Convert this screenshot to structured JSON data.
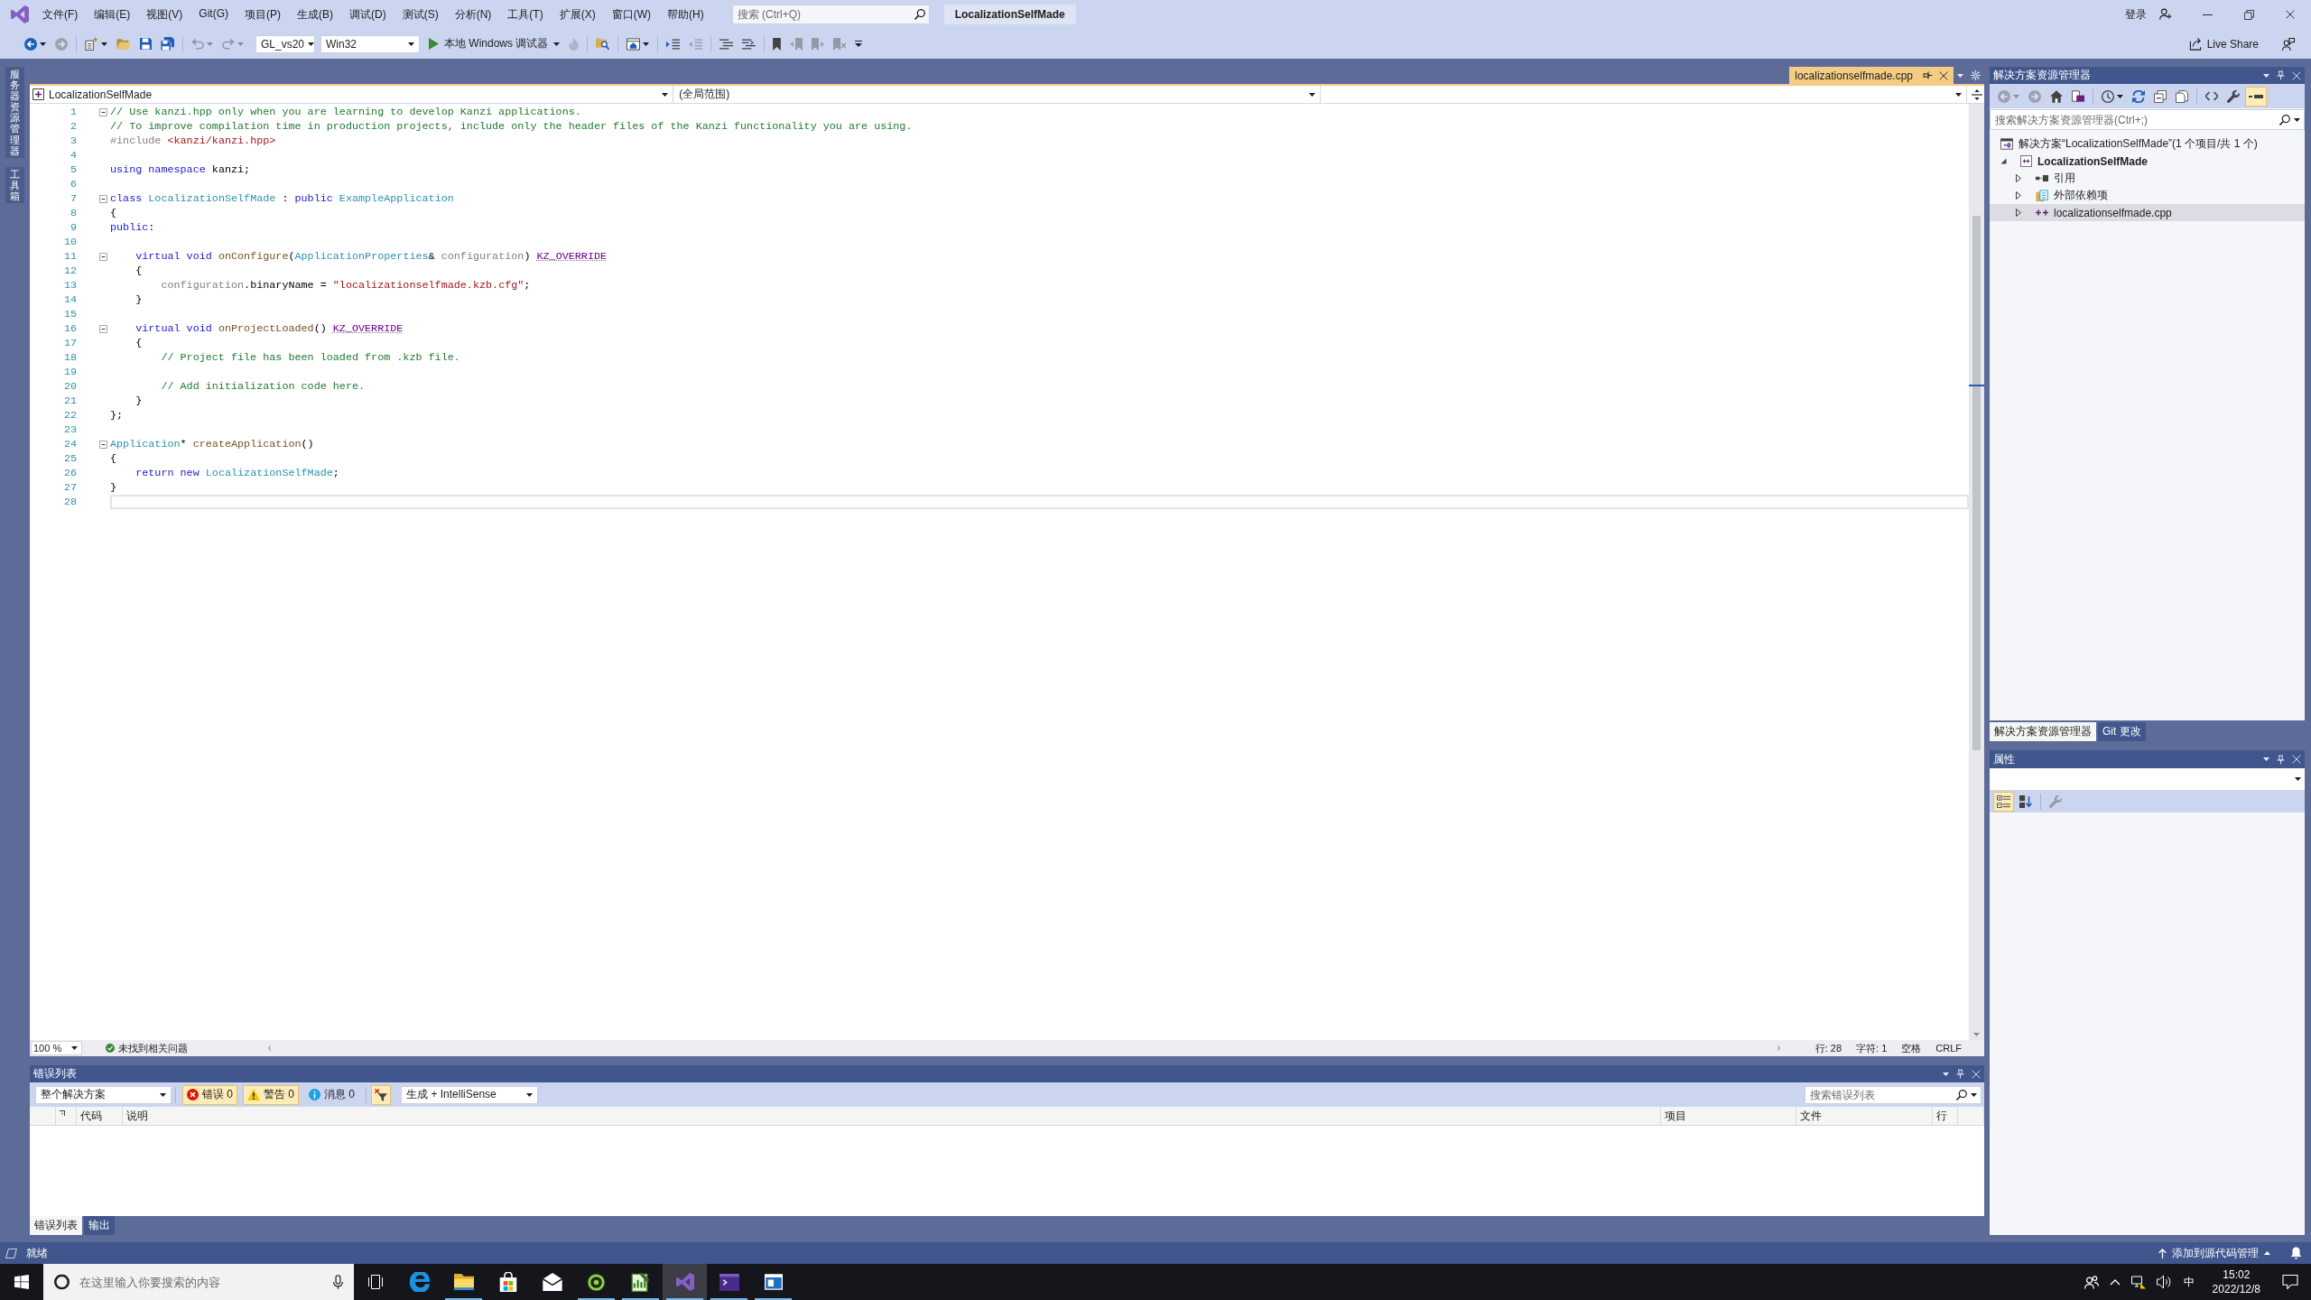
{
  "title_bar": {
    "menu": [
      "文件(F)",
      "编辑(E)",
      "视图(V)",
      "Git(G)",
      "项目(P)",
      "生成(B)",
      "调试(D)",
      "测试(S)",
      "分析(N)",
      "工具(T)",
      "扩展(X)",
      "窗口(W)",
      "帮助(H)"
    ],
    "search": {
      "placeholder": "搜索 (Ctrl+Q)"
    },
    "title": "LocalizationSelfMade",
    "account": "登录"
  },
  "toolbar": {
    "left": [
      {
        "kind": "back",
        "disabled": false
      },
      {
        "kind": "forward",
        "disabled": true
      },
      {
        "kind": "newitem",
        "disabled": false
      },
      {
        "kind": "open",
        "disabled": false
      },
      {
        "kind": "save",
        "disabled": false
      },
      {
        "kind": "saveall",
        "disabled": false
      },
      {
        "kind": "undo",
        "disabled": true
      },
      {
        "kind": "redo",
        "disabled": true
      }
    ],
    "configuration": "GL_vs20",
    "platform": "Win32",
    "debugger": "本地 Windows 调试器",
    "right": [
      {
        "kind": "flame",
        "disabled": true
      },
      {
        "kind": "findfiles",
        "disabled": false
      },
      {
        "kind": "browse",
        "disabled": false
      },
      {
        "kind": "indent",
        "disabled": false
      },
      {
        "kind": "outdent",
        "disabled": true
      },
      {
        "kind": "comment",
        "disabled": false
      },
      {
        "kind": "uncomment",
        "disabled": false
      },
      {
        "kind": "bookmark",
        "disabled": false
      },
      {
        "kind": "prevmark",
        "disabled": true
      },
      {
        "kind": "nextmark",
        "disabled": true
      },
      {
        "kind": "clearmark",
        "disabled": true
      },
      {
        "kind": "overflow",
        "disabled": false
      }
    ],
    "live_share": "Live Share"
  },
  "side_tabs": [
    "服务器资源管理器",
    "工具箱"
  ],
  "document_tabs": [
    {
      "label": "localizationselfmade.cpp",
      "selected": true
    }
  ],
  "navigation_bar": {
    "project": "LocalizationSelfMade",
    "scope": "(全局范围)"
  },
  "editor": {
    "lines": [
      {
        "number": "1",
        "fold": true,
        "current": false,
        "tokens": [
          {
            "text": "// Use kanzi.hpp only when you are learning to develop Kanzi applications.",
            "kind": "comment"
          }
        ]
      },
      {
        "number": "2",
        "fold": false,
        "current": false,
        "tokens": [
          {
            "text": "// To improve compilation time in production projects, include only the header files of the Kanzi functionality you are using.",
            "kind": "comment"
          }
        ]
      },
      {
        "number": "3",
        "fold": false,
        "current": false,
        "tokens": [
          {
            "text": "#include ",
            "kind": "preproc"
          },
          {
            "text": "<kanzi/kanzi.hpp>",
            "kind": "string"
          }
        ]
      },
      {
        "number": "4",
        "fold": false,
        "current": false
      },
      {
        "number": "5",
        "fold": false,
        "current": false,
        "tokens": [
          {
            "text": "using namespace ",
            "kind": "keyword"
          },
          {
            "text": "kanzi;",
            "kind": "plain"
          }
        ]
      },
      {
        "number": "6",
        "fold": false,
        "current": false
      },
      {
        "number": "7",
        "fold": true,
        "current": false,
        "tokens": [
          {
            "text": "class ",
            "kind": "keyword"
          },
          {
            "text": "LocalizationSelfMade",
            "kind": "type"
          },
          {
            "text": " : ",
            "kind": "plain"
          },
          {
            "text": "public ",
            "kind": "keyword"
          },
          {
            "text": "ExampleApplication",
            "kind": "type"
          }
        ]
      },
      {
        "number": "8",
        "fold": false,
        "current": false,
        "tokens": [
          {
            "text": "{",
            "kind": "plain"
          }
        ]
      },
      {
        "number": "9",
        "fold": false,
        "current": false,
        "tokens": [
          {
            "text": "public",
            "kind": "keyword"
          },
          {
            "text": ":",
            "kind": "plain"
          }
        ]
      },
      {
        "number": "10",
        "fold": false,
        "current": false
      },
      {
        "number": "11",
        "fold": true,
        "current": false,
        "tokens": [
          {
            "text": "    virtual void ",
            "kind": "keyword"
          },
          {
            "text": "onConfigure",
            "kind": "function"
          },
          {
            "text": "(",
            "kind": "plain"
          },
          {
            "text": "ApplicationProperties",
            "kind": "type"
          },
          {
            "text": "& ",
            "kind": "plain"
          },
          {
            "text": "configuration",
            "kind": "param"
          },
          {
            "text": ") ",
            "kind": "plain"
          },
          {
            "text": "KZ_OVERRIDE",
            "kind": "macro"
          }
        ]
      },
      {
        "number": "12",
        "fold": false,
        "current": false,
        "tokens": [
          {
            "text": "    {",
            "kind": "plain"
          }
        ]
      },
      {
        "number": "13",
        "fold": false,
        "current": false,
        "tokens": [
          {
            "text": "        configuration",
            "kind": "param"
          },
          {
            "text": ".binaryName = ",
            "kind": "plain"
          },
          {
            "text": "\"localizationselfmade.kzb.cfg\"",
            "kind": "string"
          },
          {
            "text": ";",
            "kind": "plain"
          }
        ]
      },
      {
        "number": "14",
        "fold": false,
        "current": false,
        "tokens": [
          {
            "text": "    }",
            "kind": "plain"
          }
        ]
      },
      {
        "number": "15",
        "fold": false,
        "current": false
      },
      {
        "number": "16",
        "fold": true,
        "current": false,
        "tokens": [
          {
            "text": "    virtual void ",
            "kind": "keyword"
          },
          {
            "text": "onProjectLoaded",
            "kind": "function"
          },
          {
            "text": "() ",
            "kind": "plain"
          },
          {
            "text": "KZ_OVERRIDE",
            "kind": "macro"
          }
        ]
      },
      {
        "number": "17",
        "fold": false,
        "current": false,
        "tokens": [
          {
            "text": "    {",
            "kind": "plain"
          }
        ]
      },
      {
        "number": "18",
        "fold": false,
        "current": false,
        "tokens": [
          {
            "text": "        // Project file has been loaded from .kzb file.",
            "kind": "comment"
          }
        ]
      },
      {
        "number": "19",
        "fold": false,
        "current": false
      },
      {
        "number": "20",
        "fold": false,
        "current": false,
        "tokens": [
          {
            "text": "        // Add initialization code here.",
            "kind": "comment"
          }
        ]
      },
      {
        "number": "21",
        "fold": false,
        "current": false,
        "tokens": [
          {
            "text": "    }",
            "kind": "plain"
          }
        ]
      },
      {
        "number": "22",
        "fold": false,
        "current": false,
        "tokens": [
          {
            "text": "};",
            "kind": "plain"
          }
        ]
      },
      {
        "number": "23",
        "fold": false,
        "current": false
      },
      {
        "number": "24",
        "fold": true,
        "current": false,
        "tokens": [
          {
            "text": "Application",
            "kind": "type"
          },
          {
            "text": "* ",
            "kind": "plain"
          },
          {
            "text": "createApplication",
            "kind": "function"
          },
          {
            "text": "()",
            "kind": "plain"
          }
        ]
      },
      {
        "number": "25",
        "fold": false,
        "current": false,
        "tokens": [
          {
            "text": "{",
            "kind": "plain"
          }
        ]
      },
      {
        "number": "26",
        "fold": false,
        "current": false,
        "tokens": [
          {
            "text": "    return new ",
            "kind": "keyword"
          },
          {
            "text": "LocalizationSelfMade",
            "kind": "type"
          },
          {
            "text": ";",
            "kind": "plain"
          }
        ]
      },
      {
        "number": "27",
        "fold": false,
        "current": false,
        "tokens": [
          {
            "text": "}",
            "kind": "plain"
          }
        ]
      },
      {
        "number": "28",
        "fold": false,
        "current": true
      }
    ]
  },
  "editor_status": {
    "zoom": "100 %",
    "issues": "未找到相关问题",
    "line": "行: 28",
    "column": "字符: 1",
    "indent": "空格",
    "line_ending": "CRLF"
  },
  "error_list": {
    "title": "错误列表",
    "scope": "整个解决方案",
    "filters": [
      {
        "kind": "error",
        "label": "错误 0",
        "selected": true
      },
      {
        "kind": "warning",
        "label": "警告 0",
        "selected": true
      },
      {
        "kind": "message",
        "label": "消息 0",
        "selected": false
      }
    ],
    "current_document_filter": {
      "selected": true
    },
    "source": "生成 + IntelliSense",
    "search": {
      "placeholder": "搜索错误列表"
    },
    "columns": [
      "代码",
      "说明",
      "项目",
      "文件",
      "行"
    ],
    "tabs": [
      {
        "label": "错误列表",
        "selected": true
      },
      {
        "label": "输出",
        "selected": false
      }
    ]
  },
  "solution_explorer": {
    "title": "解决方案资源管理器",
    "toolbar": [
      {
        "kind": "back",
        "disabled": true,
        "selected": false
      },
      {
        "kind": "forward",
        "disabled": true,
        "selected": false
      },
      {
        "kind": "home",
        "disabled": false,
        "selected": false
      },
      {
        "kind": "switchviews",
        "disabled": false,
        "selected": false
      },
      {
        "kind": "history",
        "disabled": false,
        "selected": false
      },
      {
        "kind": "sync",
        "disabled": false,
        "selected": false
      },
      {
        "kind": "collapse",
        "disabled": false,
        "selected": false
      },
      {
        "kind": "showall",
        "disabled": false,
        "selected": false
      },
      {
        "kind": "code",
        "disabled": false,
        "selected": false
      },
      {
        "kind": "wrench",
        "disabled": false,
        "selected": false
      },
      {
        "kind": "preview",
        "disabled": false,
        "selected": true
      }
    ],
    "search": {
      "placeholder": "搜索解决方案资源管理器(Ctrl+;)"
    },
    "tree": [
      {
        "label": "解决方案“LocalizationSelfMade”(1 个项目/共 1 个)",
        "kind": "solution",
        "selected": false,
        "startup": false,
        "children": [
          {
            "label": "LocalizationSelfMade",
            "kind": "project",
            "expanded": true,
            "selected": false,
            "startup": true,
            "children": [
              {
                "label": "引用",
                "kind": "references",
                "expanded": false,
                "selected": false,
                "startup": false
              },
              {
                "label": "外部依赖项",
                "kind": "external",
                "expanded": false,
                "selected": false,
                "startup": false
              },
              {
                "label": "localizationselfmade.cpp",
                "kind": "file",
                "expanded": false,
                "selected": true,
                "startup": false
              }
            ]
          }
        ]
      }
    ]
  },
  "panel_tabs": [
    {
      "label": "解决方案资源管理器",
      "selected": true
    },
    {
      "label": "Git 更改",
      "selected": false
    }
  ],
  "properties": {
    "title": "属性",
    "toolbar": [
      {
        "kind": "categorized",
        "disabled": false,
        "selected": true
      },
      {
        "kind": "alphabetical",
        "disabled": false,
        "selected": false
      },
      {
        "kind": "pages",
        "disabled": true,
        "selected": false
      }
    ]
  },
  "status_bar": {
    "text": "就绪",
    "source_control": "添加到源代码管理"
  },
  "taskbar": {
    "search": {
      "placeholder": "在这里输入你要搜索的内容"
    },
    "apps": [
      {
        "kind": "browser",
        "running": false,
        "selected": false
      },
      {
        "kind": "folder",
        "running": true,
        "selected": false
      },
      {
        "kind": "store",
        "running": false,
        "selected": false
      },
      {
        "kind": "mail",
        "running": false,
        "selected": false
      },
      {
        "kind": "eye",
        "running": true,
        "selected": false
      },
      {
        "kind": "notes",
        "running": true,
        "selected": false
      },
      {
        "kind": "ide",
        "running": true,
        "selected": true
      },
      {
        "kind": "terminal",
        "running": true,
        "selected": false
      },
      {
        "kind": "window",
        "running": true,
        "selected": false
      }
    ],
    "input_method": "中",
    "time": "15:02",
    "date": "2022/12/8"
  }
}
